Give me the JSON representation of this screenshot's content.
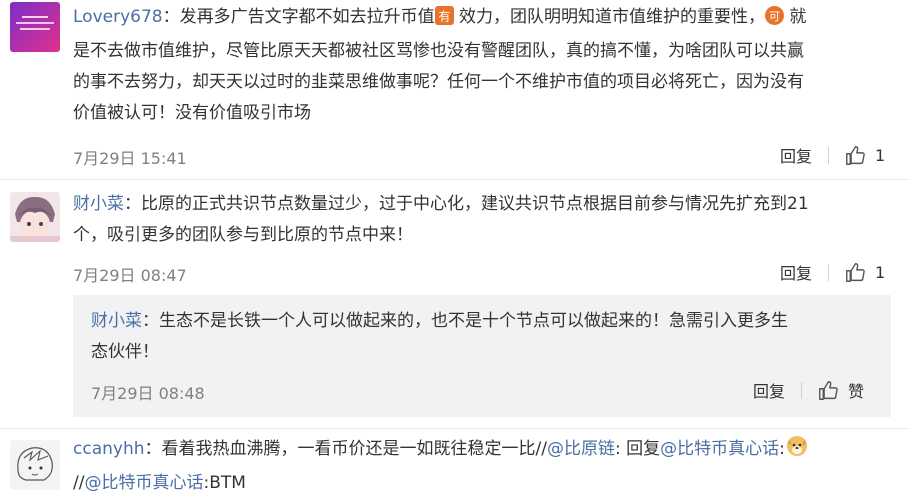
{
  "comments": [
    {
      "user": "Lovery678",
      "text1": "：发再多广告文字都不如去拉升币值",
      "badge1": "有",
      "text2": " 效力，团队明明知道市值维护的重要性，",
      "badge2": "可",
      "text3": " 就",
      "line2": "是不去做市值维护，尽管比原天天都被社区骂惨也没有警醒团队，真的搞不懂，为啥团队可以共赢",
      "line3": "的事不去努力，却天天以过时的韭菜思维做事呢？任何一个不维护市值的项目必将死亡，因为没有",
      "line4": "价值被认可！没有价值吸引市场",
      "time": "7月29日 15:41",
      "reply_label": "回复",
      "likes": "1"
    },
    {
      "user": "财小菜",
      "line1": "：比原的正式共识节点数量过少，过于中心化，建议共识节点根据目前参与情况先扩充到21",
      "line2": "个，吸引更多的团队参与到比原的节点中来！",
      "time": "7月29日 08:47",
      "reply_label": "回复",
      "likes": "1",
      "reply": {
        "user": "财小菜",
        "line1": "：生态不是长铁一个人可以做起来的，也不是十个节点可以做起来的！急需引入更多生",
        "line2": "态伙伴！",
        "time": "7月29日 08:48",
        "reply_label": "回复",
        "like_label": "赞"
      }
    },
    {
      "user": "ccanyhh",
      "text1": "：看着我热血沸腾，一看币价还是一如既往稳定一比//",
      "mention1": "@比原链",
      "text2": ": 回复",
      "mention2": "@比特币真心话",
      "text3": ":",
      "line2_prefix": "//",
      "mention3": "@比特币真心话",
      "line2_suffix": ":BTM"
    }
  ],
  "colors": {
    "link": "#4a6fa5",
    "meta": "#808080",
    "reply_bg": "#f2f2f5",
    "badge_orange": "#e8742c"
  }
}
